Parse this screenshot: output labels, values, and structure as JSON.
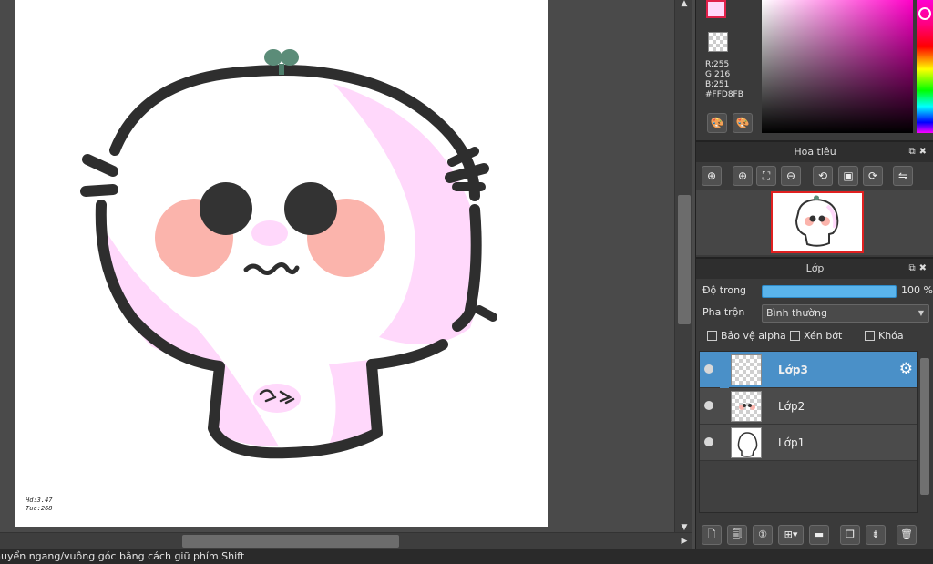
{
  "status": {
    "message": "huyển ngang/vuông góc bằng cách giữ phím Shift"
  },
  "canvas": {
    "signature_lines": [
      "Hd:3.47",
      "Tuc:268"
    ]
  },
  "color": {
    "current_hex": "#FFD8FB",
    "r_label": "R:255",
    "g_label": "G:216",
    "b_label": "B:251",
    "hex_label": "#FFD8FB",
    "palette_icons": [
      "palette-icon",
      "palette-settings-icon"
    ]
  },
  "navigator": {
    "title": "Hoa tiêu",
    "header_icons": "⧉✖",
    "tools": [
      {
        "name": "zoom-fit-icon",
        "glyph": "⊕"
      },
      {
        "name": "zoom-in-icon",
        "glyph": "⊕"
      },
      {
        "name": "fit-window-icon",
        "glyph": "⛶"
      },
      {
        "name": "zoom-out-icon",
        "glyph": "⊖"
      },
      {
        "name": "rotate-left-icon",
        "glyph": "⟲"
      },
      {
        "name": "actual-size-icon",
        "glyph": "▣"
      },
      {
        "name": "rotate-right-icon",
        "glyph": "⟳"
      },
      {
        "name": "flip-icon",
        "glyph": "⇋"
      }
    ]
  },
  "layers_panel": {
    "title": "Lớp",
    "header_icons": "⧉✖",
    "opacity_label": "Độ trong",
    "opacity_value": "100 %",
    "opacity_fraction": 1.0,
    "blend_label": "Pha trộn",
    "blend_value": "Bình thường",
    "protect_alpha_label": "Bảo vệ alpha",
    "clipping_label": "Xén bớt",
    "lock_label": "Khóa",
    "layers": [
      {
        "name": "Lớp3",
        "active": true
      },
      {
        "name": "Lớp2",
        "active": false
      },
      {
        "name": "Lớp1",
        "active": false
      }
    ],
    "toolbar": [
      {
        "name": "new-layer-icon",
        "glyph": "🗋"
      },
      {
        "name": "new-layer-from-icon",
        "glyph": "🗐"
      },
      {
        "name": "new-layer-1bit-icon",
        "glyph": "①"
      },
      {
        "name": "add-layer-menu-icon",
        "glyph": "⊞▾"
      },
      {
        "name": "new-folder-icon",
        "glyph": "▬"
      },
      {
        "name": "duplicate-layer-icon",
        "glyph": "❐"
      },
      {
        "name": "merge-down-icon",
        "glyph": "⇟"
      },
      {
        "name": "delete-layer-icon",
        "glyph": "🗑"
      }
    ]
  }
}
